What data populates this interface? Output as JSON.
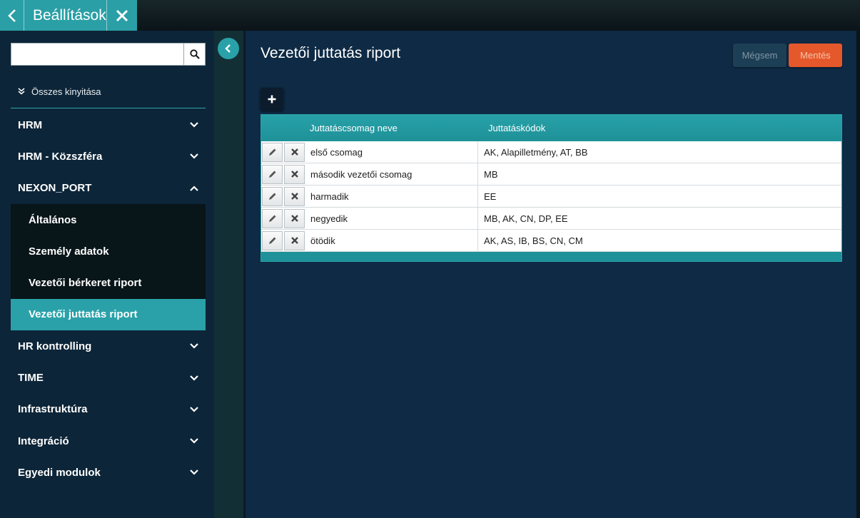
{
  "app": {
    "title": "Beállítások"
  },
  "sidebar": {
    "search": {
      "value": "",
      "placeholder": ""
    },
    "expand_all_label": "Összes kinyitása",
    "items": [
      {
        "label": "HRM",
        "expanded": false
      },
      {
        "label": "HRM - Közszféra",
        "expanded": false
      },
      {
        "label": "NEXON_PORT",
        "expanded": true
      },
      {
        "label": "HR kontrolling",
        "expanded": false
      },
      {
        "label": "TIME",
        "expanded": false
      },
      {
        "label": "Infrastruktúra",
        "expanded": false
      },
      {
        "label": "Integráció",
        "expanded": false
      },
      {
        "label": "Egyedi modulok",
        "expanded": false
      }
    ],
    "nexon_port_children": [
      {
        "label": "Általános",
        "active": false
      },
      {
        "label": "Személy adatok",
        "active": false
      },
      {
        "label": "Vezetői bérkeret riport",
        "active": false
      },
      {
        "label": "Vezetői juttatás riport",
        "active": true
      }
    ]
  },
  "main": {
    "title": "Vezetői juttatás riport",
    "cancel_label": "Mégsem",
    "save_label": "Mentés",
    "table": {
      "columns": [
        "Juttatáscsomag neve",
        "Juttatáskódok"
      ],
      "rows": [
        {
          "name": "első csomag",
          "codes": "AK, Alapilletmény, AT, BB"
        },
        {
          "name": "második vezetői csomag",
          "codes": "MB"
        },
        {
          "name": "harmadik",
          "codes": "EE"
        },
        {
          "name": "negyedik",
          "codes": "MB, AK, CN, DP, EE"
        },
        {
          "name": "ötödik",
          "codes": "AK, AS, IB, BS, CN, CM"
        }
      ]
    }
  },
  "colors": {
    "accent": "#2aa1a8",
    "save": "#e5582c",
    "sidebar_bg": "#0d2538",
    "main_bg": "#0e2a44"
  },
  "icons": {
    "back": "chevron-left-icon",
    "close": "close-icon",
    "search": "search-icon",
    "expand_all": "double-chevron-down-icon",
    "collapse_sidebar": "chevron-left-icon",
    "add": "plus-icon",
    "edit": "pencil-icon",
    "delete": "x-icon"
  }
}
